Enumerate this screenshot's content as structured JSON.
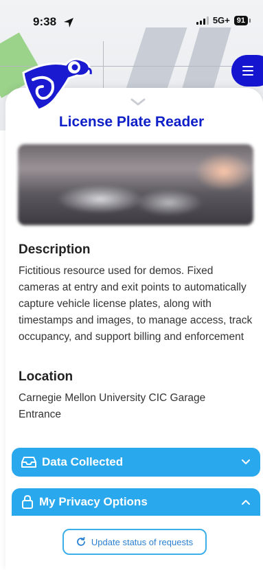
{
  "status_bar": {
    "time": "9:38",
    "network": "5G+",
    "battery": "91"
  },
  "icons": {
    "location_arrow": "location-arrow-icon",
    "signal": "signal-bars-icon",
    "menu": "hamburger-menu-icon",
    "logo": "chameleon-logo-icon",
    "sheet_handle": "chevron-down-icon",
    "data_collected": "inbox-tray-icon",
    "privacy": "lock-icon",
    "refresh": "refresh-icon"
  },
  "resource": {
    "title": "License Plate Reader",
    "description_heading": "Description",
    "description": "Fictitious resource used for demos. Fixed cameras at entry and exit points to automatically capture vehicle license plates, along with timestamps and images, to manage access, track occupancy, and support billing and enforcement",
    "location_heading": "Location",
    "location": "Carnegie Mellon University CIC Garage Entrance"
  },
  "sections": {
    "data_collected": {
      "label": "Data Collected",
      "expanded": false
    },
    "privacy_options": {
      "label": "My Privacy Options",
      "expanded": true
    }
  },
  "actions": {
    "update_status": "Update status of requests"
  },
  "colors": {
    "title": "#1020c8",
    "accordion": "#29a8ee",
    "menu_button": "#1515d0",
    "button_border": "#3aaee8"
  }
}
